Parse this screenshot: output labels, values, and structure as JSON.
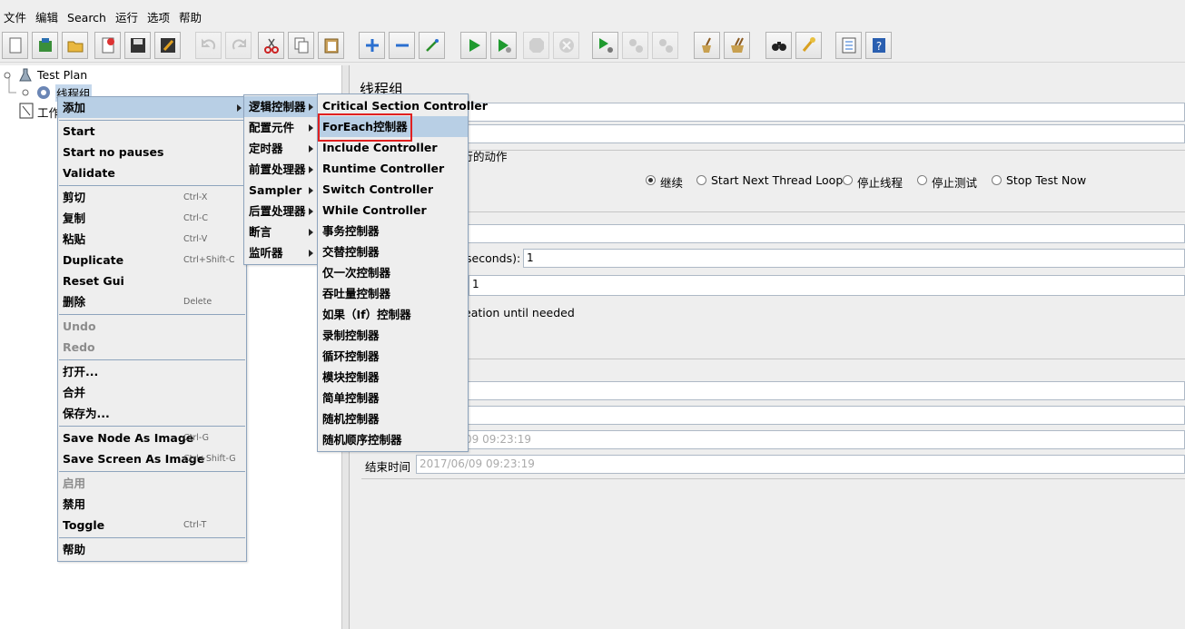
{
  "menubar": [
    "文件",
    "编辑",
    "Search",
    "运行",
    "选项",
    "帮助"
  ],
  "tree": {
    "test_plan": "Test Plan",
    "thread_group": "线程组",
    "workbench_partial": "工作"
  },
  "context_menu": {
    "add": "添加",
    "start": "Start",
    "start_no_pauses": "Start no pauses",
    "validate": "Validate",
    "cut": "剪切",
    "cut_sc": "Ctrl-X",
    "copy": "复制",
    "copy_sc": "Ctrl-C",
    "paste": "粘贴",
    "paste_sc": "Ctrl-V",
    "duplicate": "Duplicate",
    "duplicate_sc": "Ctrl+Shift-C",
    "reset_gui": "Reset Gui",
    "delete": "删除",
    "delete_sc": "Delete",
    "undo": "Undo",
    "redo": "Redo",
    "open": "打开...",
    "merge": "合并",
    "save_as": "保存为...",
    "save_node_image": "Save Node As Image",
    "save_node_image_sc": "Ctrl-G",
    "save_screen_image": "Save Screen As Image",
    "save_screen_image_sc": "Ctrl+Shift-G",
    "enable": "启用",
    "disable": "禁用",
    "toggle": "Toggle",
    "toggle_sc": "Ctrl-T",
    "help": "帮助"
  },
  "add_submenu": [
    "逻辑控制器",
    "配置元件",
    "定时器",
    "前置处理器",
    "Sampler",
    "后置处理器",
    "断言",
    "监听器"
  ],
  "logic_submenu": [
    "Critical Section Controller",
    "ForEach控制器",
    "Include Controller",
    "Runtime Controller",
    "Switch Controller",
    "While Controller",
    "事务控制器",
    "交替控制器",
    "仅一次控制器",
    "吞吐量控制器",
    "如果（If）控制器",
    "录制控制器",
    "循环控制器",
    "模块控制器",
    "简单控制器",
    "随机控制器",
    "随机顺序控制器"
  ],
  "panel": {
    "title": "线程组",
    "action_group_partial": "执行的动作",
    "radios": [
      "继续",
      "Start Next Thread Loop",
      "停止线程",
      "停止测试",
      "Stop Test Now"
    ],
    "rampup_label_partial": "seconds):",
    "rampup_value": "1",
    "loop_value": "1",
    "delay_text_partial": "eation until needed",
    "start_time_partial": "09 09:23:19",
    "end_time_label": "结束时间",
    "end_time_value": "2017/06/09 09:23:19"
  },
  "colors": {
    "highlight": "#b8cfe5",
    "menu_border": "#8ea4bd",
    "red_outline": "#e02020"
  }
}
